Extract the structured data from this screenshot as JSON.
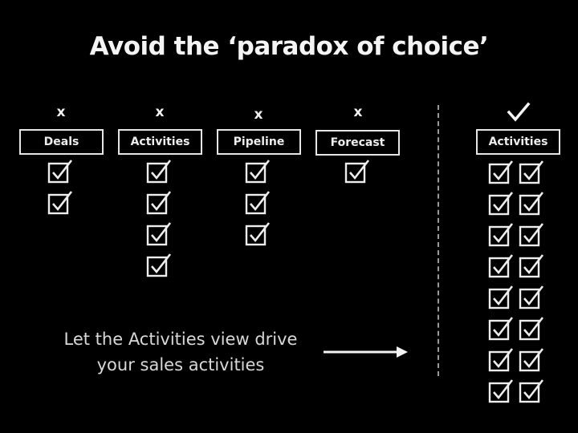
{
  "title": "Avoid the ‘paradox of choice’",
  "rejected_marker": "x",
  "chosen_marker_icon": "checkmark-icon",
  "views": [
    {
      "label": "Deals",
      "status": "rejected",
      "checkbox_rows": 2,
      "checkbox_cols": 1
    },
    {
      "label": "Activities",
      "status": "rejected",
      "checkbox_rows": 4,
      "checkbox_cols": 1
    },
    {
      "label": "Pipeline",
      "status": "rejected",
      "checkbox_rows": 3,
      "checkbox_cols": 1
    },
    {
      "label": "Forecast",
      "status": "rejected",
      "checkbox_rows": 1,
      "checkbox_cols": 1
    }
  ],
  "chosen_view": {
    "label": "Activities",
    "status": "chosen",
    "checkbox_rows": 8,
    "checkbox_cols": 2
  },
  "caption_line1": "Let the Activities view drive",
  "caption_line2": "your sales activities",
  "colors": {
    "background": "#000000",
    "foreground": "#f2f2f2",
    "divider": "#9a9a9a"
  }
}
